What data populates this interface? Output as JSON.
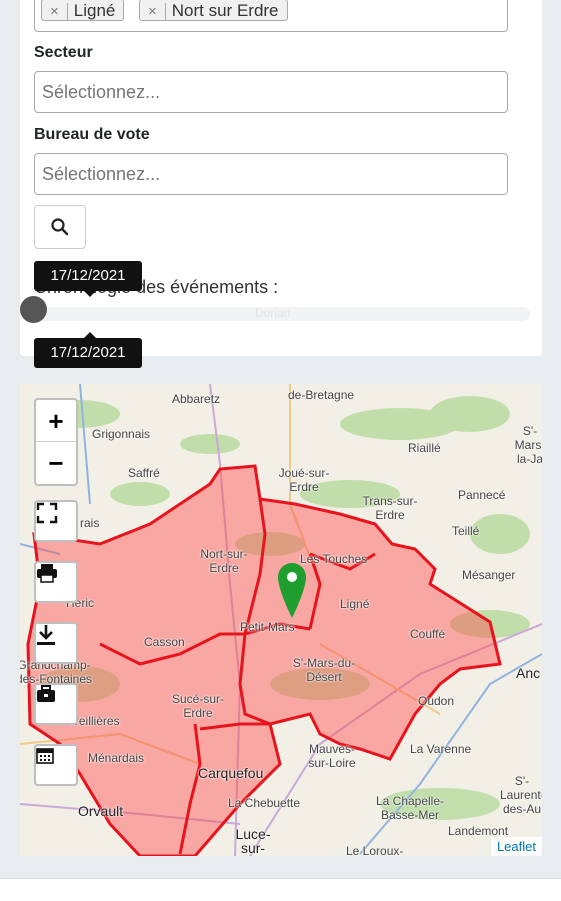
{
  "filters": {
    "communes_tags": [
      {
        "label": "Ligné",
        "remove": "×"
      },
      {
        "label": "Nort sur Erdre",
        "remove": "×"
      }
    ],
    "secteur": {
      "label": "Secteur",
      "placeholder": "Sélectionnez..."
    },
    "bureau": {
      "label": "Bureau de vote",
      "placeholder": "Sélectionnez..."
    },
    "search_icon": "search-icon"
  },
  "timeline": {
    "label": "Chronologie des événements :",
    "value_fraction": 0,
    "tooltip_top": "17/12/2021",
    "tooltip_bottom": "17/12/2021",
    "faint_text": "Dorian"
  },
  "map": {
    "zoom_in": "+",
    "zoom_out": "−",
    "controls": [
      "fullscreen-icon",
      "print-icon",
      "download-icon",
      "briefcase-icon",
      "calendar-icon"
    ],
    "attribution": "Leaflet",
    "places": [
      "Abbaretz",
      "de-Bretagne",
      "Grigonnais",
      "Riaillé",
      "Saffré",
      "S'-Mars-la-Ja",
      "Joué-sur-Erdre",
      "Trans-sur-Erdre",
      "Pannecé",
      "Teillé",
      "Nort-sur-Erdre",
      "Les Touches",
      "Mésanger",
      "Ligné",
      "Petit-Mars",
      "Couffé",
      "Casson",
      "Grandchamp-des-Fontaines",
      "S'-Mars-du-Désert",
      "Anc",
      "Sucé-sur-Erdre",
      "Oudon",
      "Treillières",
      "La Varenne",
      "Ménardais",
      "Mauves-sur-Loire",
      "Carquefou",
      "S'-Laurent-des-Au",
      "Orvault",
      "La Chebuette",
      "La Chapelle-Basse-Mer",
      "Landemont",
      "Luce-sur-Loire",
      "Le Loroux-",
      "rais",
      "Heric"
    ],
    "marker_color": "#1e9e2e",
    "polygon_color": "#e8141d"
  }
}
